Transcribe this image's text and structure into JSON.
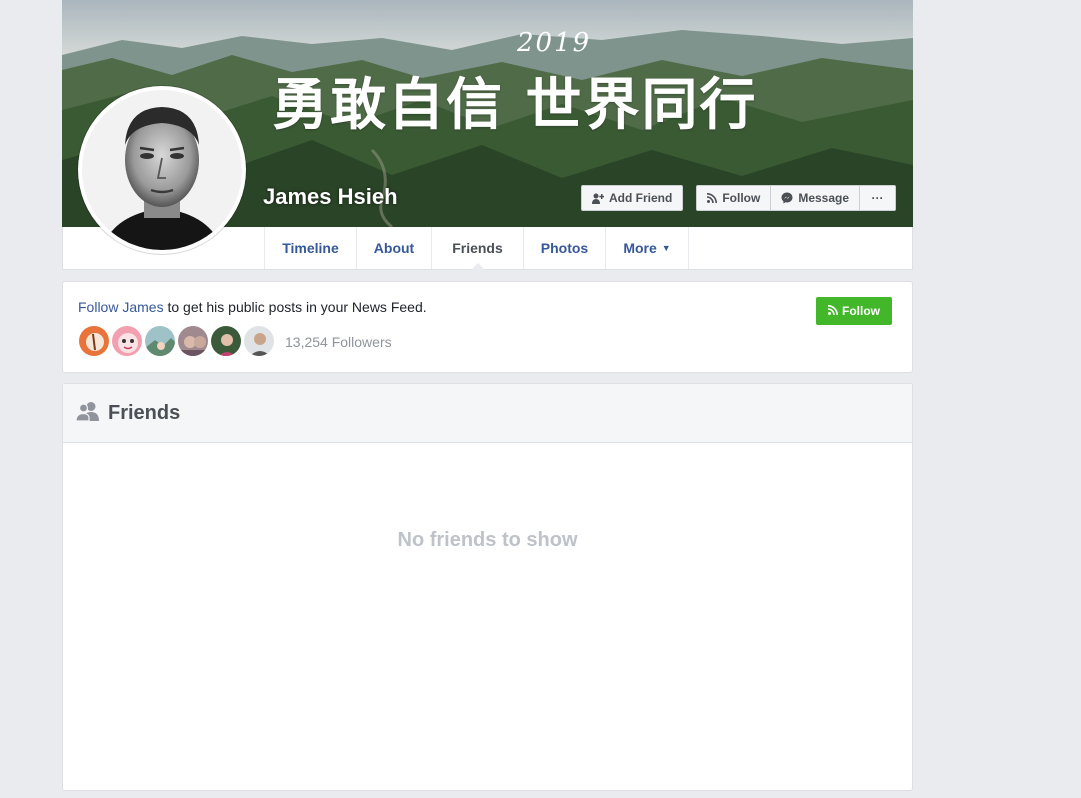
{
  "cover": {
    "year": "2019",
    "slogan": "勇敢自信 世界同行"
  },
  "profile": {
    "name": "James Hsieh"
  },
  "actions": {
    "add_friend": "Add Friend",
    "follow": "Follow",
    "message": "Message",
    "more": "···"
  },
  "nav": {
    "tabs": [
      {
        "label": "Timeline"
      },
      {
        "label": "About"
      },
      {
        "label": "Friends"
      },
      {
        "label": "Photos"
      },
      {
        "label": "More"
      }
    ],
    "active": "Friends"
  },
  "follow_card": {
    "link_text": "Follow James",
    "rest_text": " to get his public posts in your News Feed.",
    "button": "Follow",
    "followers": "13,254 Followers"
  },
  "friends": {
    "title": "Friends",
    "empty": "No friends to show"
  },
  "colors": {
    "link": "#365899",
    "follow_green": "#42b72a",
    "background": "#e9ebee"
  }
}
